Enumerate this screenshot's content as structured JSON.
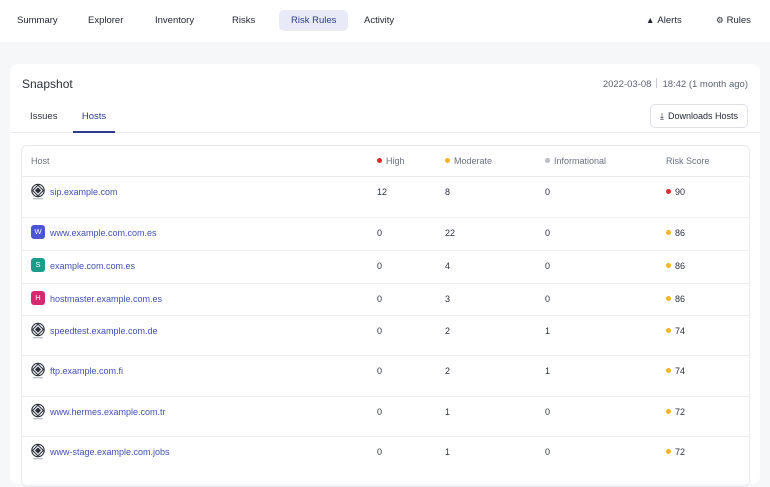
{
  "nav": {
    "tabs": [
      {
        "label": "Summary"
      },
      {
        "label": "Explorer"
      },
      {
        "label": "Inventory"
      },
      {
        "label": "Risks"
      },
      {
        "label": "Risk Rules"
      },
      {
        "label": "Activity"
      }
    ],
    "active_tab": "Risk Rules",
    "alerts_label": "Alerts",
    "rules_label": "Rules"
  },
  "snapshot": {
    "title": "Snapshot",
    "date": "2022-03-08",
    "time": "18:42 (1 month ago)",
    "subtabs": [
      {
        "label": "Issues"
      },
      {
        "label": "Hosts"
      }
    ],
    "active_subtab": "Hosts",
    "download_label": "Downloads Hosts"
  },
  "table": {
    "headers": {
      "host": "Host",
      "high": "High",
      "moderate": "Moderate",
      "informational": "Informational",
      "risk_score": "Risk Score"
    },
    "colors": {
      "high": "#e02b2b",
      "moderate": "#f5b326",
      "informational": "#b9bcc4"
    },
    "rows": [
      {
        "host": "sip.example.com",
        "icon": "brand-logo-icon",
        "high": "12",
        "moderate": "8",
        "informational": "0",
        "score": "90",
        "score_color": "#e02b2b"
      },
      {
        "host": "www.example.com.com.es",
        "icon": "letter-avatar",
        "letter": "W",
        "avatar_color": "#4b56d2",
        "high": "0",
        "moderate": "22",
        "informational": "0",
        "score": "86",
        "score_color": "#f5b326"
      },
      {
        "host": "example.com.com.es",
        "icon": "letter-avatar",
        "letter": "S",
        "avatar_color": "#1e9c8a",
        "high": "0",
        "moderate": "4",
        "informational": "0",
        "score": "86",
        "score_color": "#f5b326"
      },
      {
        "host": "hostmaster.example.com.es",
        "icon": "letter-avatar",
        "letter": "H",
        "avatar_color": "#d6286f",
        "high": "0",
        "moderate": "3",
        "informational": "0",
        "score": "86",
        "score_color": "#f5b326"
      },
      {
        "host": "speedtest.example.com.de",
        "icon": "brand-logo-icon",
        "high": "0",
        "moderate": "2",
        "informational": "1",
        "score": "74",
        "score_color": "#f5b326"
      },
      {
        "host": "ftp.example.com.fi",
        "icon": "brand-logo-icon",
        "high": "0",
        "moderate": "2",
        "informational": "1",
        "score": "74",
        "score_color": "#f5b326"
      },
      {
        "host": "www.hermes.example.com.tr",
        "icon": "brand-logo-icon",
        "high": "0",
        "moderate": "1",
        "informational": "0",
        "score": "72",
        "score_color": "#f5b326"
      },
      {
        "host": "www-stage.example.com.jobs",
        "icon": "brand-logo-icon",
        "high": "0",
        "moderate": "1",
        "informational": "0",
        "score": "72",
        "score_color": "#f5b326"
      }
    ]
  }
}
